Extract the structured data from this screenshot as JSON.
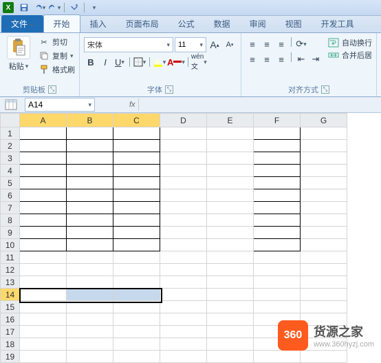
{
  "qat": {
    "app": "X"
  },
  "tabs": {
    "file": "文件",
    "home": "开始",
    "insert": "插入",
    "layout": "页面布局",
    "formulas": "公式",
    "data": "数据",
    "review": "审阅",
    "view": "视图",
    "developer": "开发工具"
  },
  "clipboard": {
    "paste": "粘贴",
    "cut": "剪切",
    "copy": "复制",
    "format": "格式刷",
    "group": "剪贴板"
  },
  "font": {
    "name": "宋体",
    "size": "11",
    "group": "字体"
  },
  "align": {
    "group": "对齐方式",
    "wrap": "自动换行",
    "merge": "合并后居"
  },
  "namebox": {
    "ref": "A14"
  },
  "fx": {
    "label": "fx"
  },
  "cols": [
    "A",
    "B",
    "C",
    "D",
    "E",
    "F",
    "G"
  ],
  "rows": [
    "1",
    "2",
    "3",
    "4",
    "5",
    "6",
    "7",
    "8",
    "9",
    "10",
    "11",
    "12",
    "13",
    "14",
    "15",
    "16",
    "17",
    "18",
    "19"
  ],
  "watermark": {
    "badge": "360",
    "title": "货源之家",
    "url": "www.360hyzj.com"
  }
}
